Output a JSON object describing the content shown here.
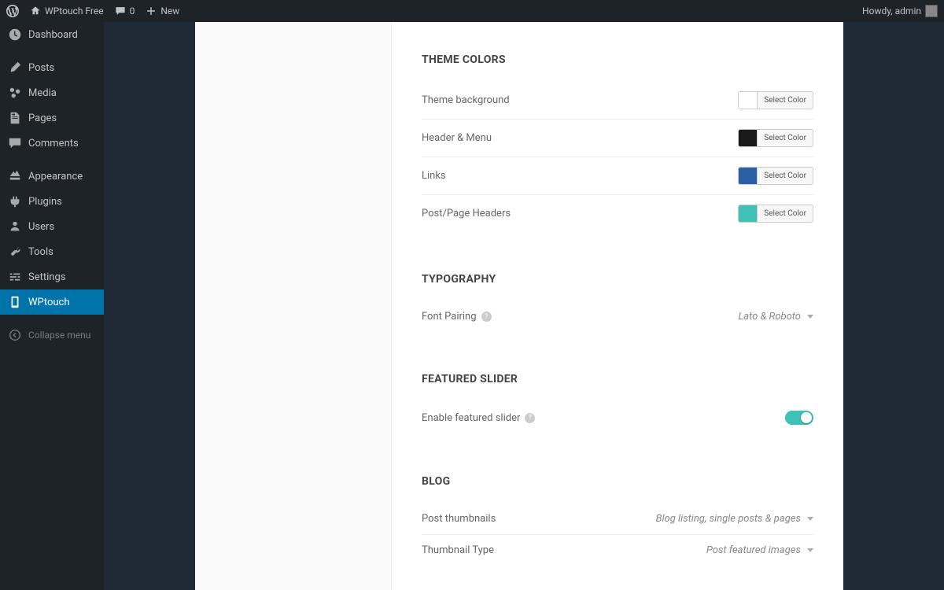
{
  "adminbar": {
    "site_name": "WPtouch Free",
    "comments_count": "0",
    "new_label": "New",
    "greeting": "Howdy, admin"
  },
  "sidebar": {
    "items": [
      {
        "label": "Dashboard",
        "icon": "dashboard"
      },
      {
        "label": "Posts",
        "icon": "posts"
      },
      {
        "label": "Media",
        "icon": "media"
      },
      {
        "label": "Pages",
        "icon": "pages"
      },
      {
        "label": "Comments",
        "icon": "comments"
      },
      {
        "label": "Appearance",
        "icon": "appearance"
      },
      {
        "label": "Plugins",
        "icon": "plugins"
      },
      {
        "label": "Users",
        "icon": "users"
      },
      {
        "label": "Tools",
        "icon": "tools"
      },
      {
        "label": "Settings",
        "icon": "settings"
      },
      {
        "label": "WPtouch",
        "icon": "wptouch"
      }
    ],
    "collapse_label": "Collapse menu"
  },
  "settings": {
    "theme_colors": {
      "title": "THEME COLORS",
      "rows": [
        {
          "label": "Theme background",
          "color": "#ffffff",
          "button": "Select Color"
        },
        {
          "label": "Header & Menu",
          "color": "#1a1a1a",
          "button": "Select Color"
        },
        {
          "label": "Links",
          "color": "#2b5fa3",
          "button": "Select Color"
        },
        {
          "label": "Post/Page Headers",
          "color": "#3fc1b7",
          "button": "Select Color"
        }
      ]
    },
    "typography": {
      "title": "TYPOGRAPHY",
      "font_pairing_label": "Font Pairing",
      "font_pairing_value": "Lato & Roboto"
    },
    "featured_slider": {
      "title": "FEATURED SLIDER",
      "enable_label": "Enable featured slider",
      "enabled": true
    },
    "blog": {
      "title": "BLOG",
      "post_thumbnails_label": "Post thumbnails",
      "post_thumbnails_value": "Blog listing, single posts & pages",
      "thumbnail_type_label": "Thumbnail Type",
      "thumbnail_type_value": "Post featured images"
    }
  }
}
